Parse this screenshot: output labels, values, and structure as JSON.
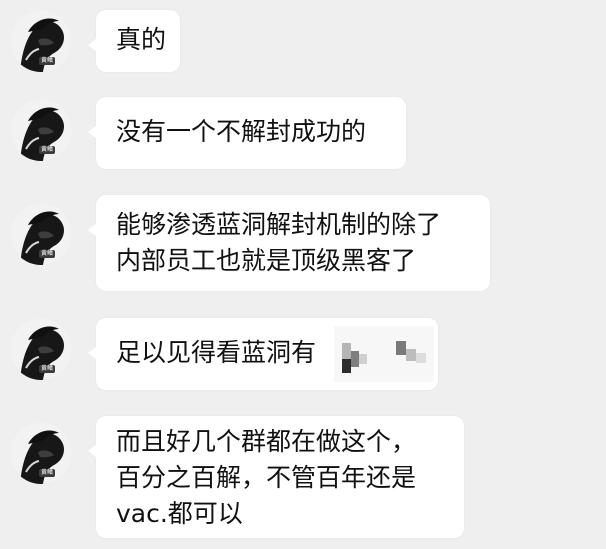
{
  "messages": [
    {
      "sender_label": "黄鳍",
      "lines": [
        "真的"
      ]
    },
    {
      "sender_label": "黄鳍",
      "lines": [
        "没有一个不解封成功的"
      ]
    },
    {
      "sender_label": "黄鳍",
      "lines": [
        "能够渗透蓝洞解封机制的除了",
        "内部员工也就是顶级黑客了"
      ]
    },
    {
      "sender_label": "黄鳍",
      "lines": [
        "足以见得看蓝洞有"
      ]
    },
    {
      "sender_label": "黄鳍",
      "lines": [
        "而且好几个群都在做这个，",
        "百分之百解，不管百年还是",
        "vac.都可以"
      ]
    }
  ]
}
